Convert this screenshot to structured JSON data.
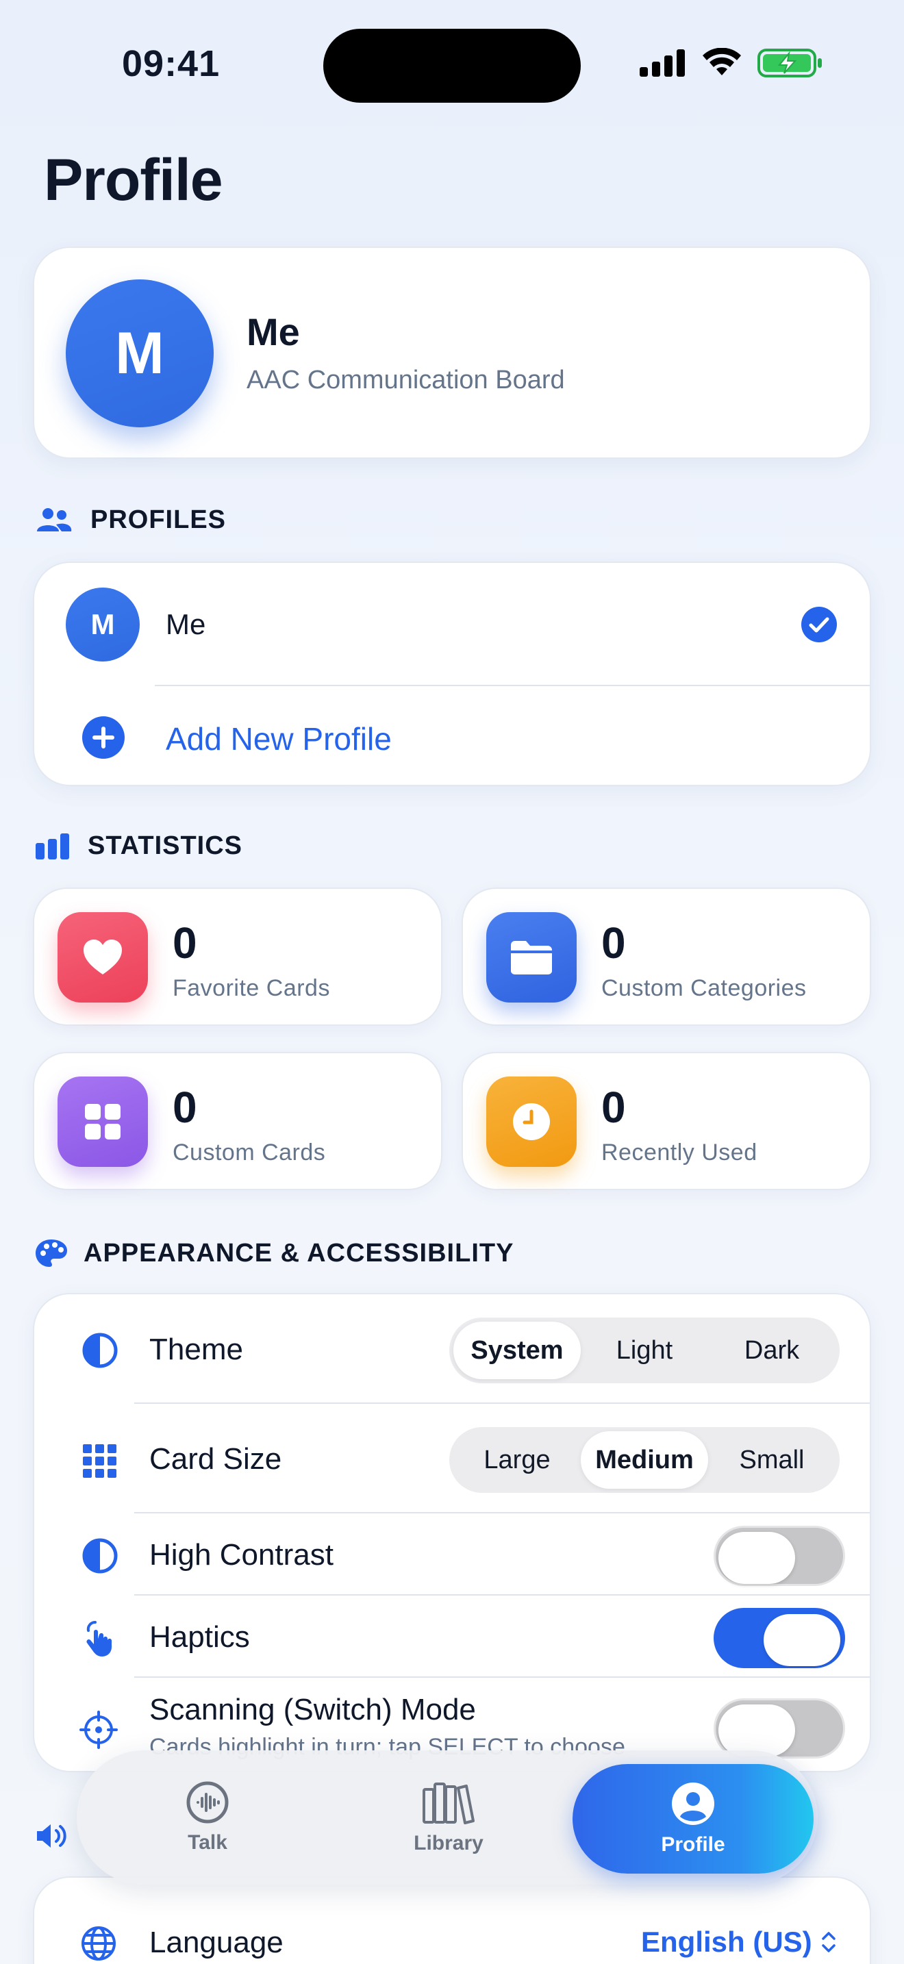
{
  "status_bar": {
    "time": "09:41"
  },
  "page_title": "Profile",
  "profile_header": {
    "initial": "M",
    "name": "Me",
    "subtitle": "AAC Communication Board"
  },
  "profiles": {
    "section_title": "PROFILES",
    "items": [
      {
        "initial": "M",
        "name": "Me",
        "selected": true
      }
    ],
    "add_label": "Add New Profile"
  },
  "statistics": {
    "section_title": "STATISTICS",
    "items": [
      {
        "value": "0",
        "label": "Favorite Cards",
        "icon": "heart-icon",
        "color": "#f04e63"
      },
      {
        "value": "0",
        "label": "Custom Categories",
        "icon": "folder-icon",
        "color": "#3b6fe8"
      },
      {
        "value": "0",
        "label": "Custom Cards",
        "icon": "grid-icon",
        "color": "#9b64ec"
      },
      {
        "value": "0",
        "label": "Recently Used",
        "icon": "clock-icon",
        "color": "#f5a524"
      }
    ]
  },
  "appearance": {
    "section_title": "APPEARANCE & ACCESSIBILITY",
    "theme": {
      "label": "Theme",
      "options": [
        "System",
        "Light",
        "Dark"
      ],
      "selected": "System"
    },
    "card_size": {
      "label": "Card Size",
      "options": [
        "Large",
        "Medium",
        "Small"
      ],
      "selected": "Medium"
    },
    "high_contrast": {
      "label": "High Contrast",
      "on": false
    },
    "haptics": {
      "label": "Haptics",
      "on": true
    },
    "scanning": {
      "label": "Scanning (Switch) Mode",
      "description": "Cards highlight in turn; tap SELECT to choose",
      "on": false
    }
  },
  "language": {
    "label": "Language",
    "value": "English (US)"
  },
  "tabbar": {
    "tabs": [
      {
        "label": "Talk",
        "icon": "waveform-icon"
      },
      {
        "label": "Library",
        "icon": "books-icon"
      },
      {
        "label": "Profile",
        "icon": "person-circle-icon",
        "active": true
      }
    ]
  },
  "colors": {
    "accent": "#2563eb",
    "background": "#eef3fb"
  }
}
